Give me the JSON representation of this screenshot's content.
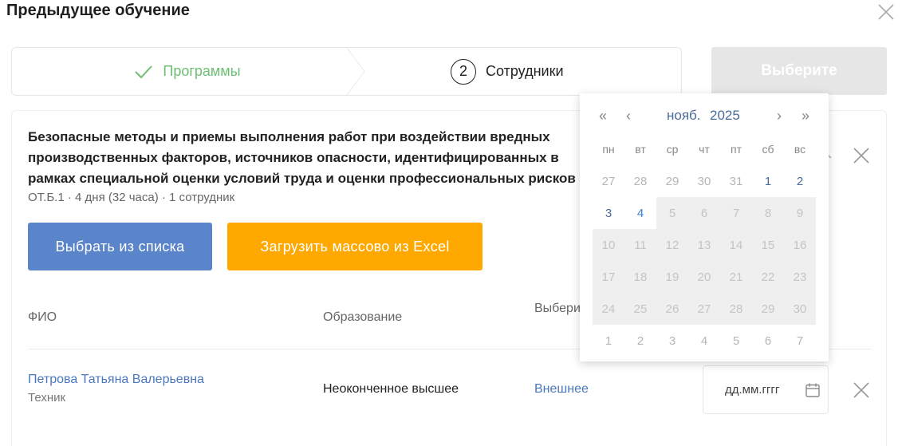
{
  "modal": {
    "title": "Предыдущее обучение"
  },
  "stepper": {
    "step1_label": "Программы",
    "step2_number": "2",
    "step2_label": "Сотрудники"
  },
  "choose_button": "Выберите",
  "course": {
    "title": "Безопасные методы и приемы выполнения работ при воздействии вредных производственных факторов, источников опасности, идентифицированных в рамках специальной оценки условий труда и оценки профессиональных рисков",
    "meta": "ОТ.Б.1 · 4 дня (32 часа) · 1 сотрудник"
  },
  "buttons": {
    "select_list": "Выбрать из списка",
    "upload_excel": "Загрузить массово из Excel"
  },
  "table": {
    "headers": {
      "fio": "ФИО",
      "education": "Образование",
      "instructor": "Выберите инструктора"
    },
    "rows": [
      {
        "name": "Петрова Татьяна Валерьевна",
        "position": "Техник",
        "education": "Неоконченное высшее",
        "instructor": "Внешнее",
        "date_placeholder": "дд.мм.гггг"
      }
    ]
  },
  "datepicker": {
    "prev_year": "«",
    "prev_month": "‹",
    "next_month": "›",
    "next_year": "»",
    "month": "нояб.",
    "year": "2025",
    "weekdays": [
      "пн",
      "вт",
      "ср",
      "чт",
      "пт",
      "сб",
      "вс"
    ],
    "weeks": [
      [
        "27",
        "28",
        "29",
        "30",
        "31",
        "1",
        "2"
      ],
      [
        "3",
        "4",
        "5",
        "6",
        "7",
        "8",
        "9"
      ],
      [
        "10",
        "11",
        "12",
        "13",
        "14",
        "15",
        "16"
      ],
      [
        "17",
        "18",
        "19",
        "20",
        "21",
        "22",
        "23"
      ],
      [
        "24",
        "25",
        "26",
        "27",
        "28",
        "29",
        "30"
      ],
      [
        "1",
        "2",
        "3",
        "4",
        "5",
        "6",
        "7"
      ]
    ],
    "today": "4"
  },
  "colors": {
    "primary": "#5b85cb",
    "excel": "#ffa800",
    "success": "#6fbf73",
    "link": "#4a78bf"
  }
}
